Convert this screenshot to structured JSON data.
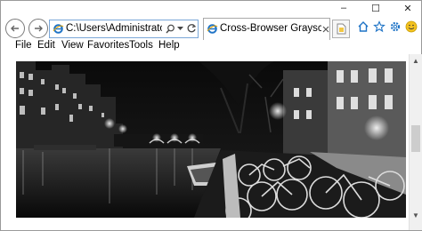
{
  "window": {
    "minimize": "–",
    "maximize": "☐",
    "close": "✕"
  },
  "address": {
    "url": "C:\\Users\\Administrator\\Desl"
  },
  "tab": {
    "title": "Cross-Browser Grayscale im…"
  },
  "menu": {
    "items": [
      "File",
      "Edit",
      "View",
      "Favorites",
      "Tools",
      "Help"
    ]
  },
  "colors": {
    "accent": "#1e73c6",
    "smiley": "#f3c220"
  }
}
